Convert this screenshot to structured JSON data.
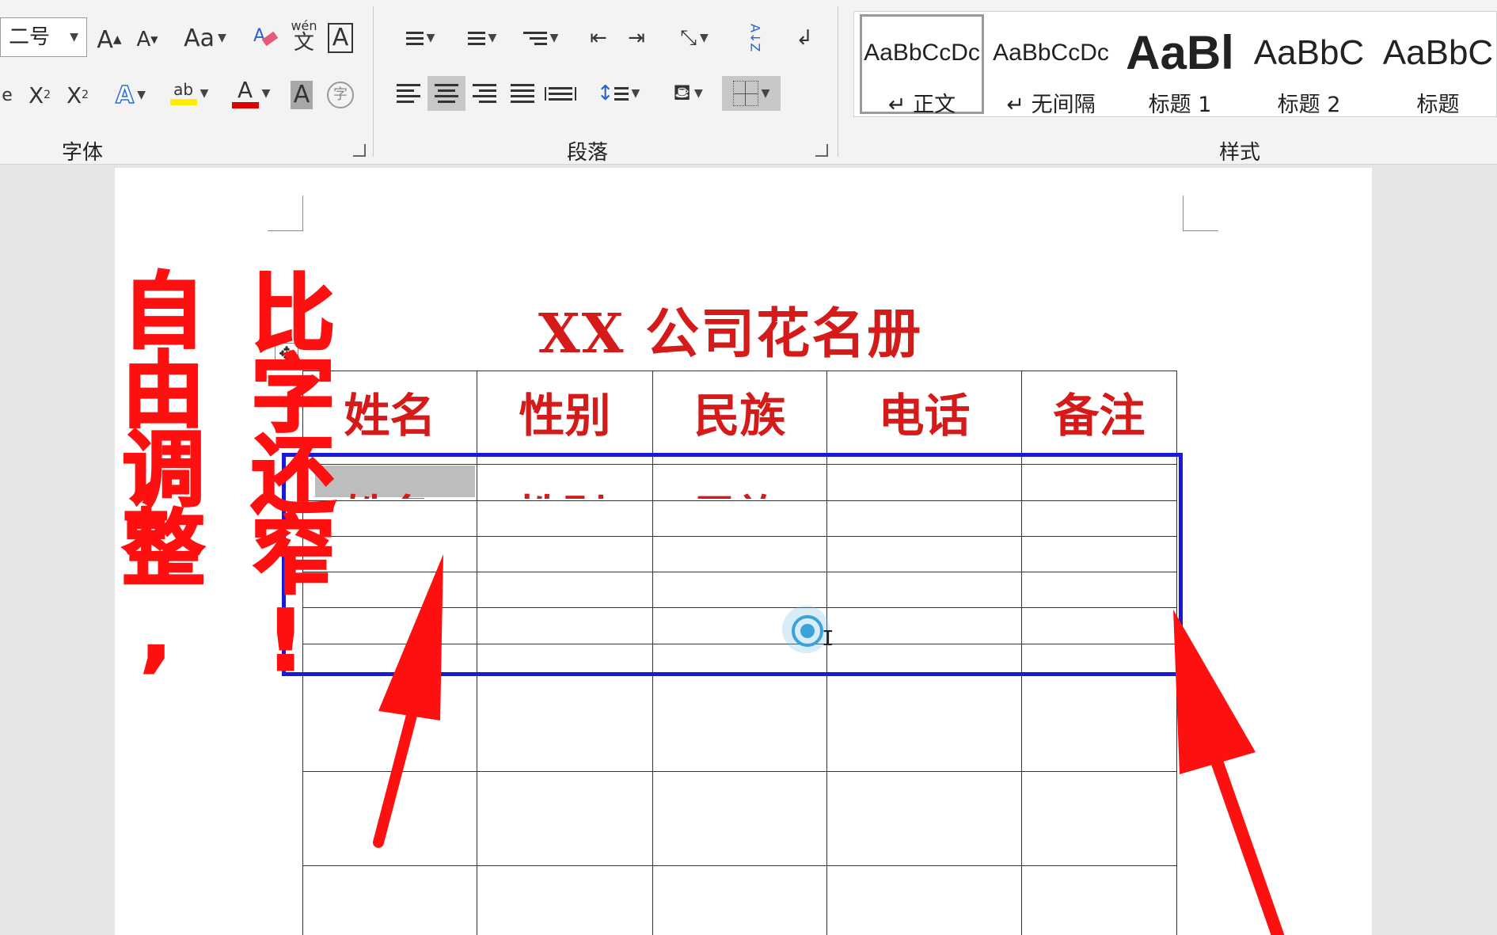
{
  "ribbon": {
    "font_group": {
      "label": "字体",
      "font_size": "二号",
      "grow_font": "A",
      "shrink_font": "A",
      "change_case": "Aa",
      "phonetic_top": "wén",
      "phonetic_bottom": "文",
      "char_border": "A",
      "subscript": "X",
      "subscript_mark": "2",
      "superscript": "X",
      "superscript_mark": "2",
      "text_effects": "A",
      "highlight": "ab",
      "font_color": "A",
      "char_shading": "A",
      "enclose_char": "字"
    },
    "paragraph_group": {
      "label": "段落",
      "sort": "A↓Z"
    },
    "styles_group": {
      "label": "样式",
      "items": [
        {
          "sample": "AaBbCcDc",
          "name": "↵ 正文"
        },
        {
          "sample": "AaBbCcDc",
          "name": "↵ 无间隔"
        },
        {
          "sample": "AaBl",
          "name": "标题 1"
        },
        {
          "sample": "AaBbC",
          "name": "标题 2"
        },
        {
          "sample": "AaBbC",
          "name": "标题"
        }
      ]
    }
  },
  "document": {
    "title": "XX 公司花名册",
    "table": {
      "headers": [
        "姓名",
        "性别",
        "民族",
        "电话",
        "备注"
      ],
      "partial_row": [
        "姓名",
        "性别",
        "民族"
      ]
    }
  },
  "annotations": {
    "left_text": "自由调整,",
    "right_text": "比字还窄!"
  },
  "colors": {
    "title_red": "#d51a1a",
    "selection_blue": "#1a1ad4",
    "annotation_red": "#ff1010"
  }
}
